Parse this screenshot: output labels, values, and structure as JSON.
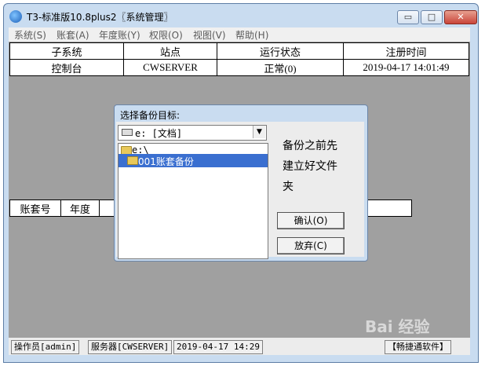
{
  "window": {
    "title": "T3-标准版10.8plus2〖系统管理〗",
    "minimize": "▭",
    "maximize": "□",
    "close": "✕"
  },
  "menu": [
    "系统(S)",
    "账套(A)",
    "年度账(Y)",
    "权限(O)",
    "视图(V)",
    "帮助(H)"
  ],
  "table_top": {
    "headers": [
      "子系统",
      "站点",
      "运行状态",
      "注册时间"
    ],
    "rows": [
      [
        "控制台",
        "CWSERVER",
        "正常(0)",
        "2019-04-17 14:01:49"
      ]
    ]
  },
  "table_bottom": {
    "headers": [
      "账套号",
      "年度"
    ]
  },
  "dialog": {
    "title": "选择备份目标:",
    "drive_value": "e: [文档]",
    "tree": [
      "e:\\",
      "001账套备份"
    ],
    "note_lines": [
      "备份之前先",
      "建立好文件",
      "夹"
    ],
    "ok_label": "确认(O)",
    "cancel_label": "放弃(C)"
  },
  "statusbar": {
    "operator": "操作员[admin]",
    "server": "服务器[CWSERVER]",
    "datetime": "2019-04-17 14:29",
    "brand": "【畅捷通软件】"
  },
  "watermark": "Bai 经验"
}
